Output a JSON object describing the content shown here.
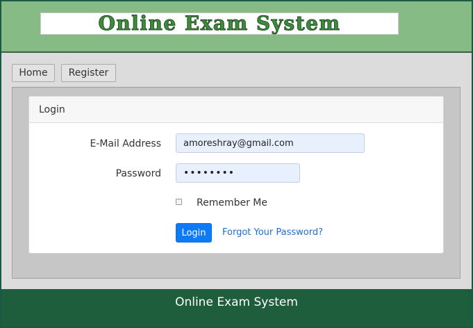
{
  "header": {
    "logo_text": "Online Exam System"
  },
  "nav": {
    "home_label": "Home",
    "register_label": "Register"
  },
  "login_card": {
    "title": "Login",
    "email_label": "E-Mail Address",
    "email_value": "amoreshray@gmail.com",
    "password_label": "Password",
    "password_value": "••••••••",
    "remember_label": "Remember Me",
    "remember_checked": false,
    "login_button": "Login",
    "forgot_link": "Forgot Your Password?"
  },
  "footer": {
    "text": "Online Exam System"
  },
  "colors": {
    "header_bg": "#87bb85",
    "footer_bg": "#1e5e3c",
    "primary_button": "#0d7bf5",
    "link": "#1a6fd6",
    "input_autofill_bg": "#e8f0fe"
  }
}
